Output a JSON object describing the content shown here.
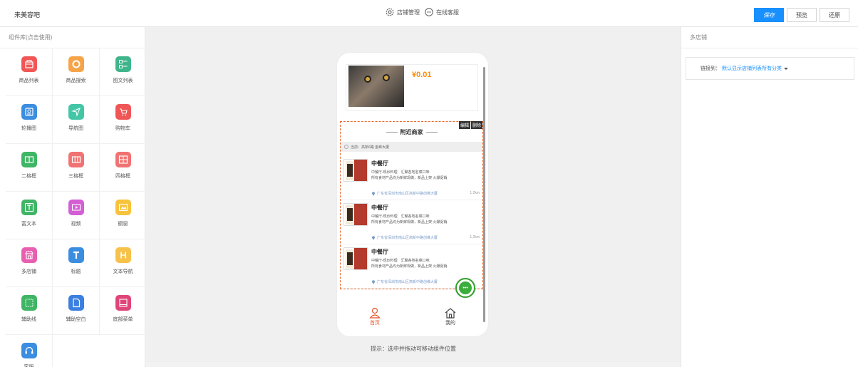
{
  "app": {
    "brand": "来美容吧"
  },
  "toolbar": {
    "shop_manage": "店铺管理",
    "online_service": "在线客服",
    "save": "保存",
    "preview": "预览",
    "restore": "还原"
  },
  "left_panel": {
    "title": "组件库(点击使用)",
    "components": [
      {
        "label": "商品列表",
        "icon": "shop-bag-icon",
        "color": "#f05656"
      },
      {
        "label": "商品搜索",
        "icon": "search-ring-icon",
        "color": "#f6a44a"
      },
      {
        "label": "图文列表",
        "icon": "image-text-list-icon",
        "color": "#3fb58c"
      },
      {
        "label": "轮播图",
        "icon": "carousel-icon",
        "color": "#3b8de0"
      },
      {
        "label": "导航图",
        "icon": "navigation-icon",
        "color": "#43c6a5"
      },
      {
        "label": "购物车",
        "icon": "cart-icon",
        "color": "#f05656"
      },
      {
        "label": "二格框",
        "icon": "two-grid-icon",
        "color": "#3fb565"
      },
      {
        "label": "三格框",
        "icon": "three-grid-icon",
        "color": "#f07272"
      },
      {
        "label": "四格框",
        "icon": "four-grid-icon",
        "color": "#f07272"
      },
      {
        "label": "富文本",
        "icon": "rich-text-icon",
        "color": "#3fb565"
      },
      {
        "label": "视频",
        "icon": "video-icon",
        "color": "#d45ed4"
      },
      {
        "label": "橱窗",
        "icon": "showcase-icon",
        "color": "#f7c23c"
      },
      {
        "label": "多店铺",
        "icon": "multi-store-icon",
        "color": "#e85fb0"
      },
      {
        "label": "标题",
        "icon": "title-t-icon",
        "color": "#3b8de0"
      },
      {
        "label": "文本导航",
        "icon": "text-nav-h-icon",
        "color": "#f7c24a"
      },
      {
        "label": "辅助线",
        "icon": "guide-line-icon",
        "color": "#3fb565"
      },
      {
        "label": "辅助空白",
        "icon": "blank-doc-icon",
        "color": "#3b7fe0"
      },
      {
        "label": "底部菜单",
        "icon": "bottom-menu-icon",
        "color": "#e0457a"
      },
      {
        "label": "客服",
        "icon": "headset-icon",
        "color": "#3b8de0"
      }
    ]
  },
  "phone": {
    "product_price": "¥0.01",
    "edit_label": "编辑",
    "delete_label": "删除",
    "nearby_title": "附近商家",
    "location": "当前：高新6路 金峰大厦",
    "stores": [
      {
        "name": "中餐厅",
        "desc1": "中餐厅-现炒料理　汇聚各地名菜口味",
        "desc2": "所有食材产品均为新鲜现做，新品上架 火爆促销",
        "address": "广东省深圳市南山区高新中路创维大厦",
        "distance": "1.2km"
      },
      {
        "name": "中餐厅",
        "desc1": "中餐厅-现炒料理　汇聚各地名菜口味",
        "desc2": "所有食材产品均为新鲜现做，新品上架 火爆促销",
        "address": "广东省深圳市南山区高新中路创维大厦",
        "distance": "1.2km"
      },
      {
        "name": "中餐厅",
        "desc1": "中餐厅-现炒料理　汇聚各地名菜口味",
        "desc2": "所有食材产品均为新鲜现做，新品上架 火爆促销",
        "address": "广东省深圳市南山区高新中路创维大厦",
        "distance": ""
      }
    ],
    "tabs": [
      {
        "label": "首页",
        "icon": "person-icon",
        "active": true
      },
      {
        "label": "我的",
        "icon": "home-icon",
        "active": false
      }
    ]
  },
  "canvas": {
    "hint": "提示：选中并拖动可移动组件位置"
  },
  "right_panel": {
    "title": "多店铺",
    "link_label": "链接到：",
    "link_value": "默认显示店铺列表所有分类"
  },
  "colors": {
    "primary": "#1890ff",
    "accent_orange": "#ff8a00",
    "dashed_border": "#e86a2c",
    "tab_active": "#e8542b"
  }
}
